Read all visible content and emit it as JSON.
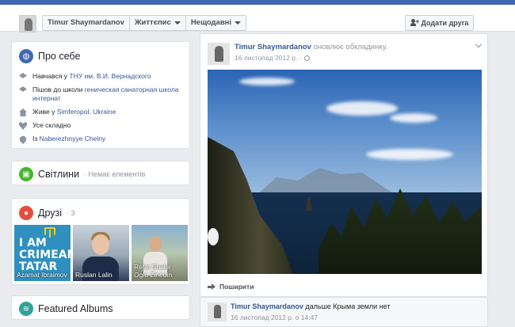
{
  "header": {
    "name": "Timur Shaymardanov",
    "timeline_label": "Життєпис",
    "recent_label": "Нещодавні",
    "add_friend_label": "Додати друга"
  },
  "about": {
    "title": "Про себе",
    "rows": [
      {
        "icon": "graduation-cap-icon",
        "prefix": "Навчався у ",
        "link": "ТНУ им. В.И. Вернадского"
      },
      {
        "icon": "graduation-cap-icon",
        "prefix": "Пішов до школи ",
        "link": "геническая санаторная школа интернат"
      },
      {
        "icon": "home-icon",
        "prefix": "Живе у ",
        "link": "Simferopol, Ukraine"
      },
      {
        "icon": "heart-icon",
        "prefix": "",
        "text": "Усе складно"
      },
      {
        "icon": "location-pin-icon",
        "prefix": "Із ",
        "link": "Naberezhnyye Chelny"
      }
    ]
  },
  "highlights": {
    "title": "Світлини",
    "note": "· Немає елементів"
  },
  "friends": {
    "title": "Друзі",
    "count": "· 3",
    "tile1_text": "I AM\nCRIMEAN\nTATAR",
    "items": [
      {
        "name": "Azamat Ibraimov"
      },
      {
        "name": "Ruslan Lalin"
      },
      {
        "name": "Refat Shakir\nOglu Zinedin"
      }
    ]
  },
  "albums": {
    "title": "Featured Albums"
  },
  "post": {
    "author": "Timur Shaymardanov",
    "action": " оновлює обкладинку.",
    "date": "16 листопад 2012 р. ·",
    "share_label": "Поширити"
  },
  "post2": {
    "author": "Timur Shaymardanov",
    "text": " дальше Крыма земли нет",
    "date": "16 листопад 2012 р. о 14:47"
  },
  "colors": {
    "brand": "#4267b2",
    "link": "#365899",
    "background": "#e9ebee"
  }
}
